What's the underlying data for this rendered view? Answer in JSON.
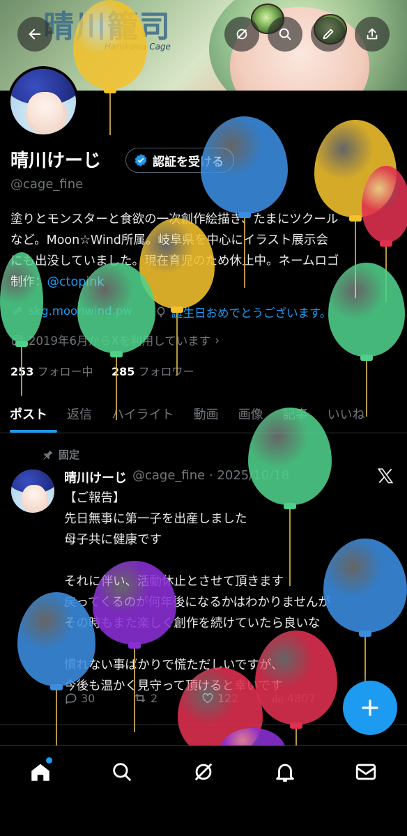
{
  "banner": {
    "logo_text": "晴川籠司",
    "logo_sub": "Harukawa Cage"
  },
  "profile": {
    "name": "晴川けーじ",
    "verify_label": "認証を受ける",
    "handle": "@cage_fine",
    "bio_lines": [
      "塗りとモンスターと食欲の一次創作絵描き、たまにツクール",
      "など。Moon☆Wind所属。岐阜県を中心にイラスト展示会",
      "にも出没していました。現在育児のため休止中。ネームロゴ",
      "制作："
    ],
    "bio_link": "@ctopink",
    "website": "skg.moonwind.pw",
    "birthday": "誕生日おめでとうございます。",
    "joined": "2019年6月からXを利用しています",
    "following_count": "253",
    "following_label": "フォロー中",
    "followers_count": "285",
    "followers_label": "フォロワー"
  },
  "tabs": [
    "ポスト",
    "返信",
    "ハイライト",
    "動画",
    "画像",
    "記事",
    "いいね"
  ],
  "post": {
    "pinned_label": "固定",
    "author": "晴川けーじ",
    "handle_date": "@cage_fine · 2025/10/18",
    "lines": [
      "【ご報告】",
      "先日無事に第一子を出産しました",
      "母子共に健康です",
      "",
      "それに伴い、活動休止とさせて頂きます",
      "戻ってくるのが何年後になるかはわかりませんが",
      "その時もまた楽しく創作を続けていたら良いな",
      "",
      "慣れない事ばかりで慌ただしいですが、",
      "今後も温かく見守って頂けると幸いです"
    ],
    "replies": "30",
    "reposts": "2",
    "likes": "122",
    "views": "4807"
  },
  "colors": {
    "accent": "#1d9bf0",
    "balloon_yellow": "#f2c12e",
    "balloon_blue": "#3b8de0",
    "balloon_green": "#4fd08a",
    "balloon_red": "#e0304f",
    "balloon_purple": "#8a2fd6"
  },
  "icons": {
    "top_bar": [
      "back-arrow-icon",
      "grok-icon",
      "search-icon",
      "edit-icon",
      "share-icon"
    ],
    "bottom_nav": [
      "home-icon",
      "search-icon",
      "grok-icon",
      "bell-icon",
      "mail-icon"
    ]
  }
}
